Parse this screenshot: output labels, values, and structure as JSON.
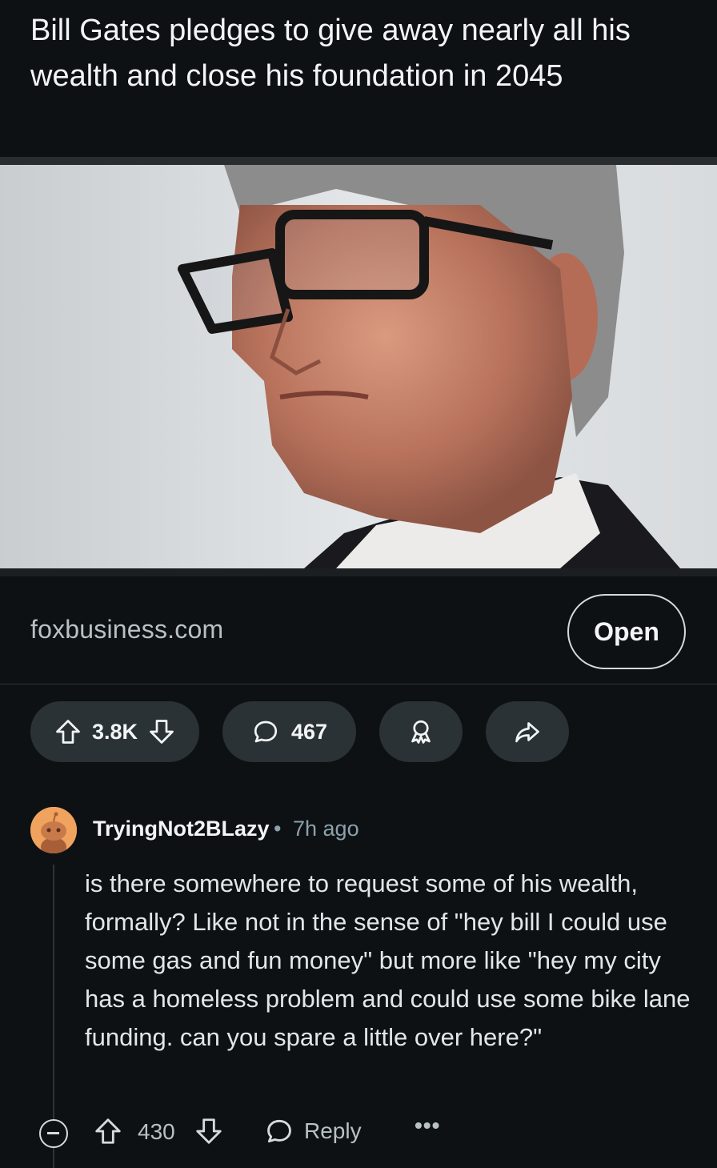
{
  "post": {
    "title": "Bill Gates pledges to give away nearly all his wealth and close his foundation in 2045",
    "image_alt": "Close-up portrait photo of Bill Gates wearing glasses",
    "domain": "foxbusiness.com",
    "open_label": "Open",
    "votes": "3.8K",
    "comments": "467"
  },
  "comment": {
    "author": "TryingNot2BLazy",
    "separator": "•",
    "time": "7h ago",
    "body": "is there somewhere to request some of his wealth, formally? Like not in the sense of \"hey bill I could use some gas and fun money\" but more like \"hey my city has a homeless problem and could use some bike lane funding. can you spare a little over here?\"",
    "score": "430",
    "reply_label": "Reply",
    "more_label": "•••"
  },
  "colors": {
    "background": "#0e1113",
    "pill": "#2a3236",
    "avatar": "#f0a35e",
    "muted_text": "#8ba2ad"
  },
  "icons": [
    "upvote-icon",
    "downvote-icon",
    "comment-icon",
    "award-icon",
    "share-icon",
    "collapse-icon",
    "reply-icon",
    "more-icon"
  ]
}
